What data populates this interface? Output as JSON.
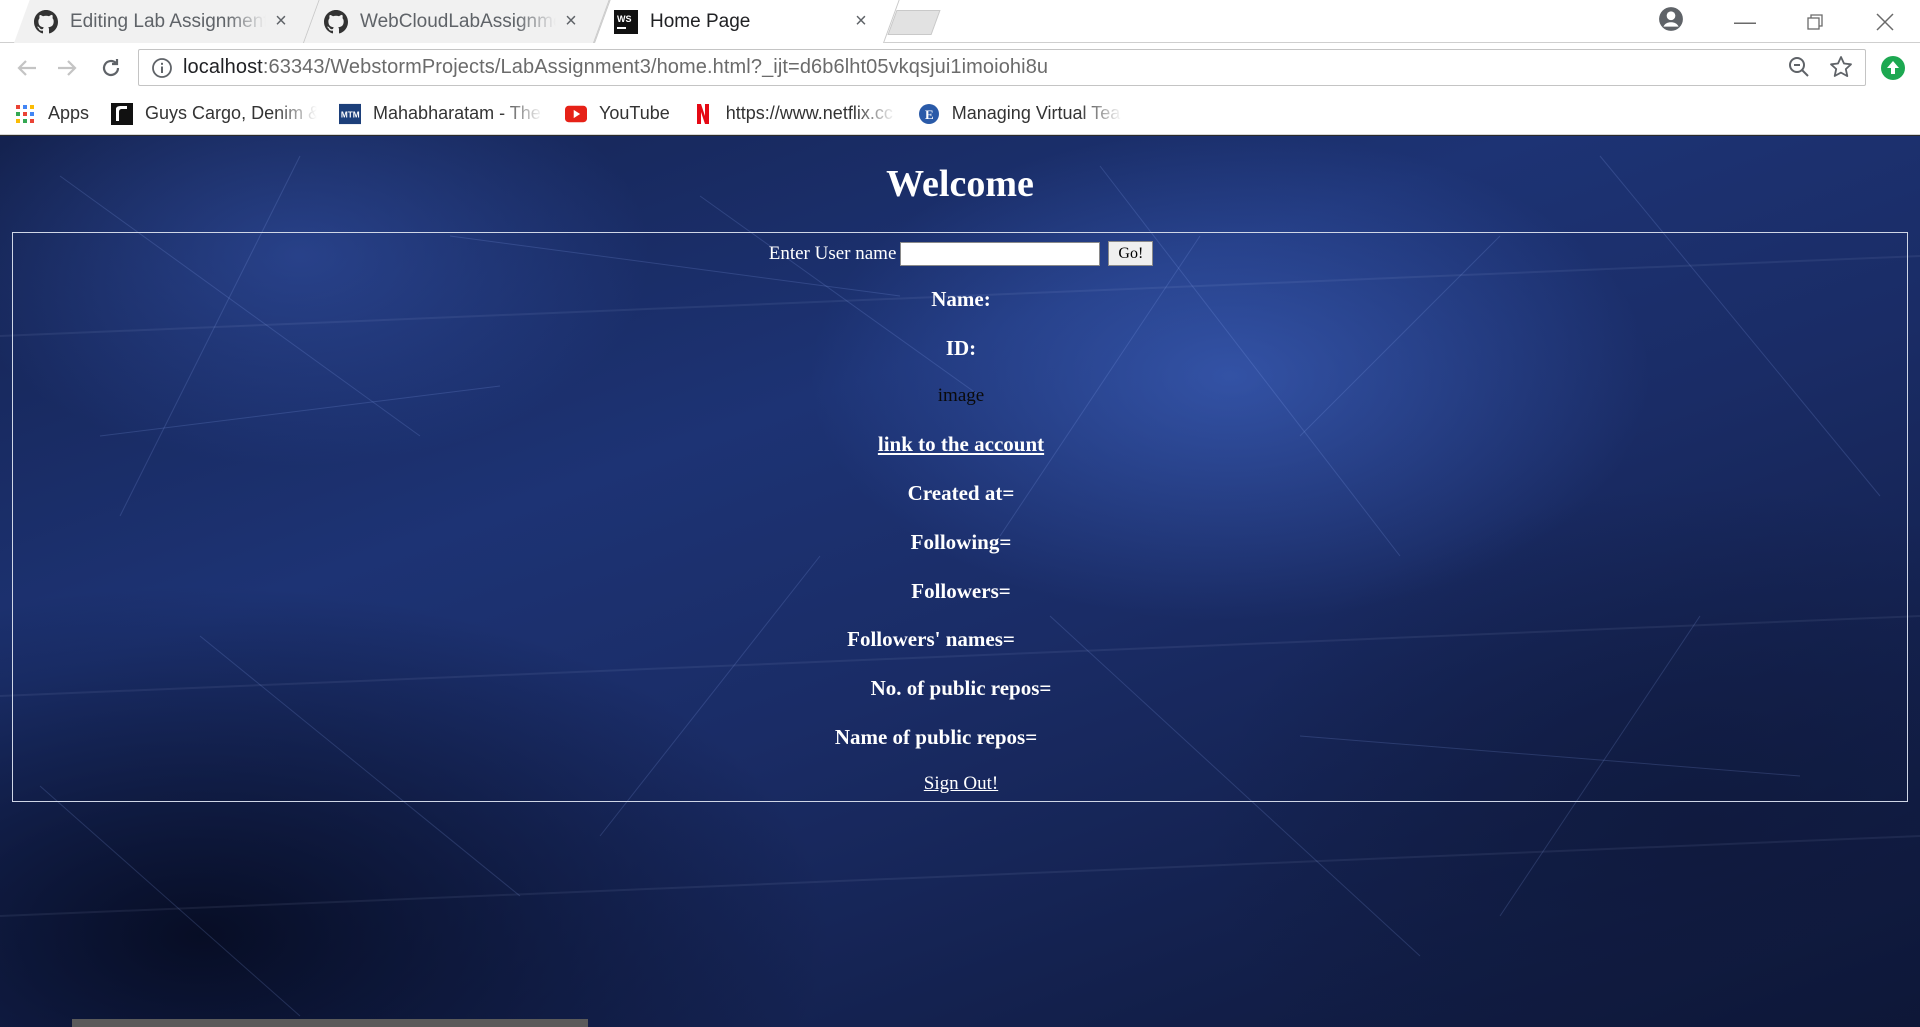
{
  "browser": {
    "tabs": [
      {
        "title": "Editing Lab Assignment 3",
        "icon": "github-icon",
        "close": "×"
      },
      {
        "title": "WebCloudLabAssignment",
        "icon": "github-icon",
        "close": "×"
      },
      {
        "title": "Home Page",
        "icon": "webstorm-icon",
        "close": "×",
        "active": true
      }
    ],
    "address": {
      "host": "localhost",
      "path": ":63343/WebstormProjects/LabAssignment3/home.html?_ijt=d6b6lht05vkqsjui1imoiohi8u"
    },
    "bookmarks": [
      {
        "label": "Apps",
        "icon": "apps-grid-icon"
      },
      {
        "label": "Guys Cargo, Denim &",
        "icon": "guys-cargo-icon"
      },
      {
        "label": "Mahabharatam - The",
        "icon": "mahabharatam-icon"
      },
      {
        "label": "YouTube",
        "icon": "youtube-icon"
      },
      {
        "label": "https://www.netflix.cc",
        "icon": "netflix-icon"
      },
      {
        "label": "Managing Virtual Tea",
        "icon": "edx-icon"
      }
    ]
  },
  "page": {
    "heading": "Welcome",
    "username_label": "Enter User name",
    "username_value": "",
    "go_button": "Go!",
    "name_label": "Name:",
    "id_label": "ID:",
    "image_alt": "image",
    "account_link": "link to the account",
    "created_label": "Created at=",
    "following_label": "Following=",
    "followers_label": "Followers=",
    "follower_names_label": "Followers' names=",
    "public_repos_count_label": "No. of public repos=",
    "public_repos_names_label": "Name of public repos=",
    "signout": "Sign Out!"
  },
  "colors": {
    "background_blue": "#1d3374",
    "text": "#ffffff",
    "panel_border": "#cfd6e6"
  }
}
